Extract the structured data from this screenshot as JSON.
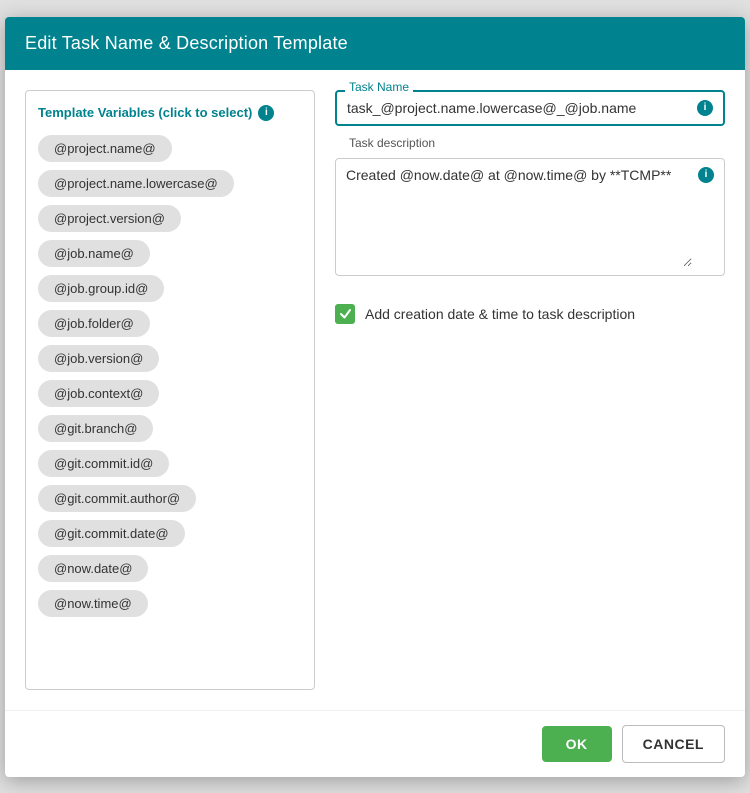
{
  "dialog": {
    "title": "Edit Task Name & Description Template",
    "header_bg": "#00838f"
  },
  "left_panel": {
    "header_label": "Template Variables (click to select)",
    "variables": [
      "@project.name@",
      "@project.name.lowercase@",
      "@project.version@",
      "@job.name@",
      "@job.group.id@",
      "@job.folder@",
      "@job.version@",
      "@job.context@",
      "@git.branch@",
      "@git.commit.id@",
      "@git.commit.author@",
      "@git.commit.date@",
      "@now.date@",
      "@now.time@"
    ]
  },
  "right_panel": {
    "task_name_label": "Task Name",
    "task_name_value": "task_@project.name.lowercase@_@job.name",
    "task_desc_label": "Task description",
    "task_desc_value": "Created @now.date@ at @now.time@ by **TCMP**",
    "checkbox_label": "Add creation date & time to task description",
    "checkbox_checked": true
  },
  "footer": {
    "ok_label": "OK",
    "cancel_label": "CANCEL"
  }
}
